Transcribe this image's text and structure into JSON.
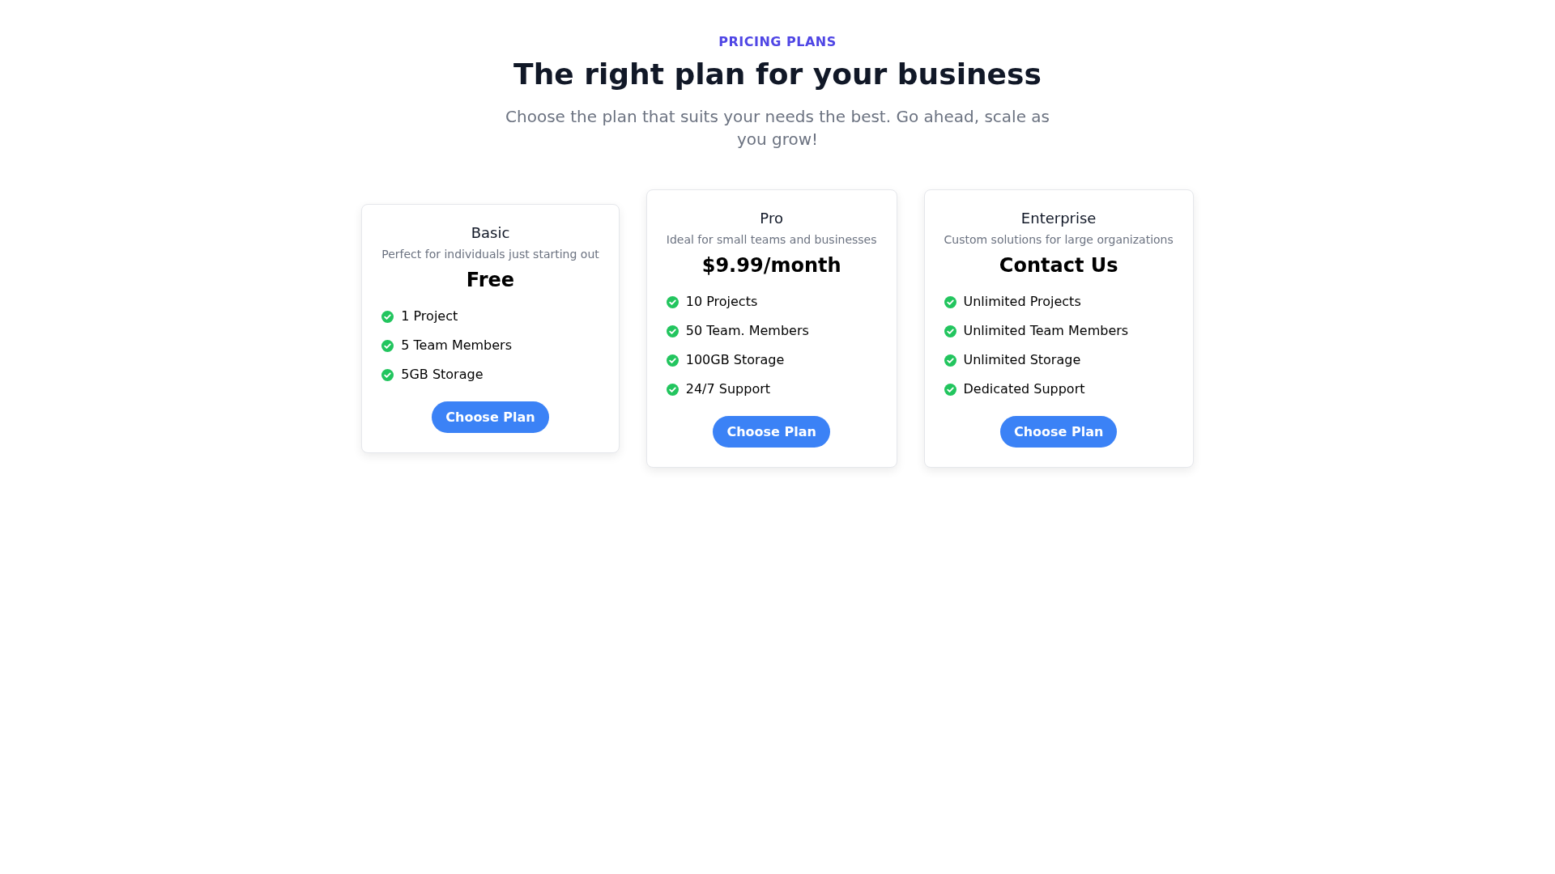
{
  "eyebrow": "PRICING PLANS",
  "title": "The right plan for your business",
  "subtitle": "Choose the plan that suits your needs the best. Go ahead, scale as you grow!",
  "plans": [
    {
      "name": "Basic",
      "description": "Perfect for individuals just starting out",
      "price": "Free",
      "features": [
        "1 Project",
        "5 Team Members",
        "5GB Storage"
      ],
      "button": "Choose Plan"
    },
    {
      "name": "Pro",
      "description": "Ideal for small teams and businesses",
      "price": "$9.99/month",
      "features": [
        "10 Projects",
        "50 Team. Members",
        "100GB Storage",
        "24/7 Support"
      ],
      "button": "Choose Plan"
    },
    {
      "name": "Enterprise",
      "description": "Custom solutions for large organizations",
      "price": "Contact Us",
      "features": [
        "Unlimited Projects",
        "Unlimited Team Members",
        "Unlimited Storage",
        "Dedicated Support"
      ],
      "button": "Choose Plan"
    }
  ]
}
